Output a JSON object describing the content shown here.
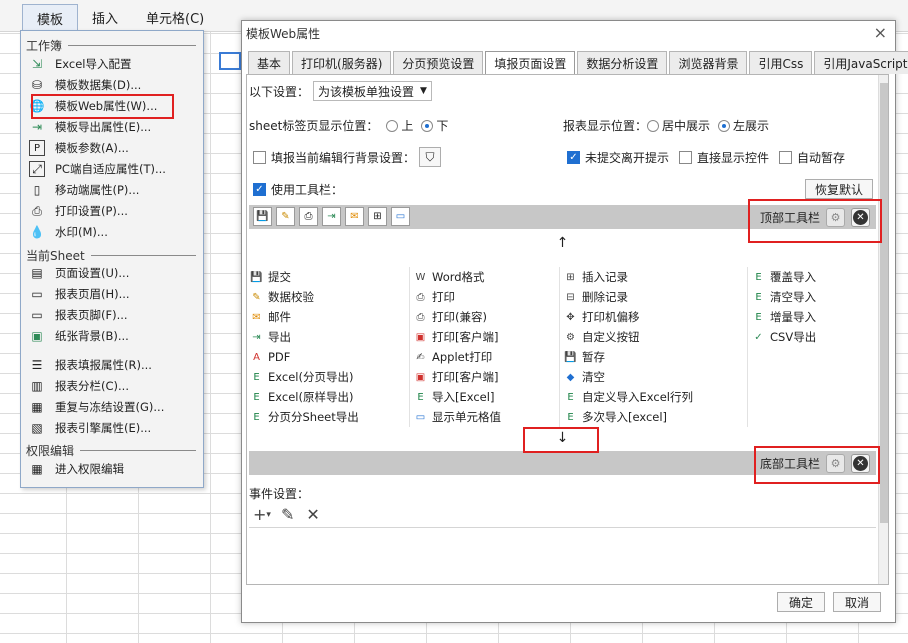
{
  "menubar": {
    "items": [
      "模板",
      "插入",
      "单元格(C)"
    ]
  },
  "dropdown": {
    "sections": [
      "工作簿",
      "当前Sheet",
      "权限编辑"
    ],
    "items": [
      {
        "label": "Excel导入配置",
        "icon": "excel-import-icon"
      },
      {
        "label": "模板数据集(D)...",
        "icon": "dataset-icon"
      },
      {
        "label": "模板Web属性(W)...",
        "icon": "web-globe-icon"
      },
      {
        "label": "模板导出属性(E)...",
        "icon": "export-icon"
      },
      {
        "label": "模板参数(A)...",
        "icon": "parameter-icon"
      },
      {
        "label": "PC端自适应属性(T)...",
        "icon": "adaptive-icon"
      },
      {
        "label": "移动端属性(P)...",
        "icon": "mobile-icon"
      },
      {
        "label": "打印设置(P)...",
        "icon": "printer-icon"
      },
      {
        "label": "水印(M)...",
        "icon": "watermark-icon"
      },
      {
        "label": "页面设置(U)...",
        "icon": "page-setup-icon"
      },
      {
        "label": "报表页眉(H)...",
        "icon": "header-icon"
      },
      {
        "label": "报表页脚(F)...",
        "icon": "footer-icon"
      },
      {
        "label": "纸张背景(B)...",
        "icon": "paper-background-icon"
      },
      {
        "label": "报表填报属性(R)...",
        "icon": "fill-property-icon"
      },
      {
        "label": "报表分栏(C)...",
        "icon": "columns-icon"
      },
      {
        "label": "重复与冻结设置(G)...",
        "icon": "freeze-icon"
      },
      {
        "label": "报表引擎属性(E)...",
        "icon": "engine-icon"
      },
      {
        "label": "进入权限编辑",
        "icon": "permission-icon"
      }
    ]
  },
  "dialog": {
    "title": "模板Web属性",
    "close": "×",
    "tabs": [
      "基本",
      "打印机(服务器)",
      "分页预览设置",
      "填报页面设置",
      "数据分析设置",
      "浏览器背景",
      "引用Css",
      "引用JavaScript"
    ],
    "active_tab": "填报页面设置",
    "setting_label": "以下设置：",
    "setting_value": "为该模板单独设置",
    "sheet_pos_label": "sheet标签页显示位置：",
    "sheet_pos_options": [
      "上",
      "下"
    ],
    "sheet_pos_selected": "下",
    "report_pos_label": "报表显示位置：",
    "report_pos_options": [
      "居中展示",
      "左展示"
    ],
    "report_pos_selected": "左展示",
    "fill_bg_label": "填报当前编辑行背景设置：",
    "unsubmitted_label": "未提交离开提示",
    "unsubmitted_checked": true,
    "direct_show_label": "直接显示控件",
    "auto_save_label": "自动暂存",
    "use_toolbar_label": "使用工具栏：",
    "use_toolbar_checked": true,
    "restore_default": "恢复默认",
    "top_toolbar_label": "顶部工具栏",
    "bottom_toolbar_label": "底部工具栏",
    "up_arrow": "↑",
    "down_arrow": "↓",
    "top_toolbar_icons": [
      "save-icon",
      "edit-icon",
      "print-icon",
      "export-icon",
      "mail-icon",
      "insert-record-icon",
      "display-cell-icon"
    ],
    "buttons": [
      {
        "label": "提交",
        "icon": "save-icon"
      },
      {
        "label": "Word格式",
        "icon": "word-icon"
      },
      {
        "label": "插入记录",
        "icon": "insert-record-icon"
      },
      {
        "label": "覆盖导入",
        "icon": "excel-icon"
      },
      {
        "label": "数据校验",
        "icon": "verify-icon"
      },
      {
        "label": "打印",
        "icon": "print-icon"
      },
      {
        "label": "删除记录",
        "icon": "delete-record-icon"
      },
      {
        "label": "清空导入",
        "icon": "excel-icon"
      },
      {
        "label": "邮件",
        "icon": "mail-icon"
      },
      {
        "label": "打印(兼容)",
        "icon": "print-icon"
      },
      {
        "label": "打印机偏移",
        "icon": "offset-icon"
      },
      {
        "label": "增量导入",
        "icon": "excel-icon"
      },
      {
        "label": "导出",
        "icon": "export-icon"
      },
      {
        "label": "打印[客户端]",
        "icon": "client-print-icon"
      },
      {
        "label": "自定义按钮",
        "icon": "gear-icon"
      },
      {
        "label": "CSV导出",
        "icon": "csv-icon"
      },
      {
        "label": "PDF",
        "icon": "pdf-icon"
      },
      {
        "label": "Applet打印",
        "icon": "applet-icon"
      },
      {
        "label": "暂存",
        "icon": "save-icon"
      },
      {
        "label": "",
        "icon": ""
      },
      {
        "label": "Excel(分页导出)",
        "icon": "excel-icon"
      },
      {
        "label": "打印[客户端]",
        "icon": "pdf-print-icon"
      },
      {
        "label": "清空",
        "icon": "eraser-icon"
      },
      {
        "label": "",
        "icon": ""
      },
      {
        "label": "Excel(原样导出)",
        "icon": "excel-icon"
      },
      {
        "label": "导入[Excel]",
        "icon": "excel-icon"
      },
      {
        "label": "自定义导入Excel行列",
        "icon": "excel-icon"
      },
      {
        "label": "",
        "icon": ""
      },
      {
        "label": "分页分Sheet导出",
        "icon": "excel-icon"
      },
      {
        "label": "显示单元格值",
        "icon": "display-cell-icon"
      },
      {
        "label": "多次导入[excel]",
        "icon": "excel-icon"
      },
      {
        "label": "",
        "icon": ""
      }
    ],
    "events_label": "事件设置：",
    "ok": "确定",
    "cancel": "取消"
  },
  "colors": {
    "accent": "#1f6fd1",
    "highlight": "#e02020",
    "toolbar_bg": "#c7c7c7",
    "menu_bg": "#f3f3f3"
  }
}
